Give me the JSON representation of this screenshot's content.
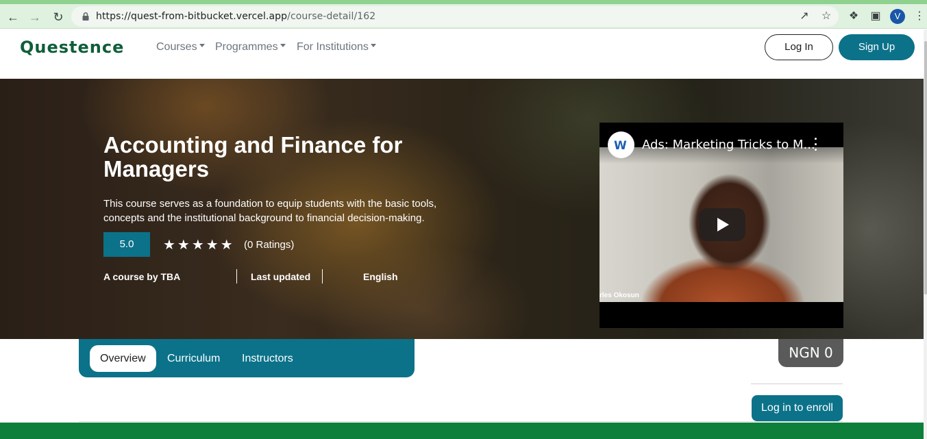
{
  "browser": {
    "url_host": "https://quest-from-bitbucket.vercel.app",
    "url_path": "/course-detail/162",
    "profile_initial": "V"
  },
  "header": {
    "logo": "Questence",
    "nav": [
      "Courses",
      "Programmes",
      "For Institutions"
    ],
    "login_label": "Log In",
    "signup_label": "Sign Up"
  },
  "course": {
    "title": "Accounting and Finance for Managers",
    "description": "This course serves as a foundation to equip students with the basic tools, concepts and the institutional background to financial decision-making.",
    "rating": "5.0",
    "stars": "★★★★★",
    "ratings_count": "(0 Ratings)",
    "by": "A course by TBA",
    "last_updated": "Last updated",
    "language": "English"
  },
  "video": {
    "title": "Ads: Marketing Tricks to M...",
    "caption": "rles Okosun"
  },
  "tabs": [
    "Overview",
    "Curriculum",
    "Instructors"
  ],
  "enroll": {
    "price": "NGN 0",
    "button": "Log in to enroll"
  },
  "colors": {
    "accent": "#0b7289",
    "brand_green": "#0f5e3a",
    "footer_green": "#0d7f3a"
  }
}
